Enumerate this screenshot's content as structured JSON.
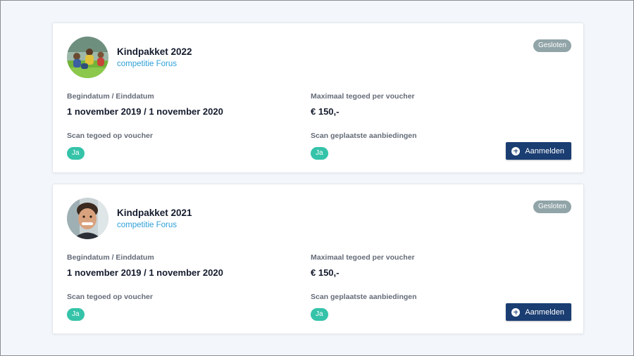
{
  "funds": [
    {
      "title": "Kindpakket 2022",
      "organization": "competitie Forus",
      "status": "Gesloten",
      "date_label": "Begindatum / Einddatum",
      "date_value": "1 november 2019 / 1 november 2020",
      "max_label": "Maximaal tegoed per voucher",
      "max_value": "€ 150,-",
      "scan_voucher_label": "Scan tegoed op voucher",
      "scan_voucher_value": "Ja",
      "scan_offers_label": "Scan geplaatste aanbiedingen",
      "scan_offers_value": "Ja",
      "button_label": "Aanmelden",
      "button_icon": "plus-circle-icon"
    },
    {
      "title": "Kindpakket 2021",
      "organization": "competitie Forus",
      "status": "Gesloten",
      "date_label": "Begindatum / Einddatum",
      "date_value": "1 november 2019 / 1 november 2020",
      "max_label": "Maximaal tegoed per voucher",
      "max_value": "€ 150,-",
      "scan_voucher_label": "Scan tegoed op voucher",
      "scan_voucher_value": "Ja",
      "scan_offers_label": "Scan geplaatste aanbiedingen",
      "scan_offers_value": "Ja",
      "button_label": "Aanmelden",
      "button_icon": "plus-circle-icon"
    }
  ],
  "colors": {
    "background": "#f3f6fa",
    "title": "#141b2d",
    "link": "#2d9fd8",
    "status_badge": "#91a4a8",
    "yes_pill": "#35c3a9",
    "primary_button": "#1a3d72"
  }
}
